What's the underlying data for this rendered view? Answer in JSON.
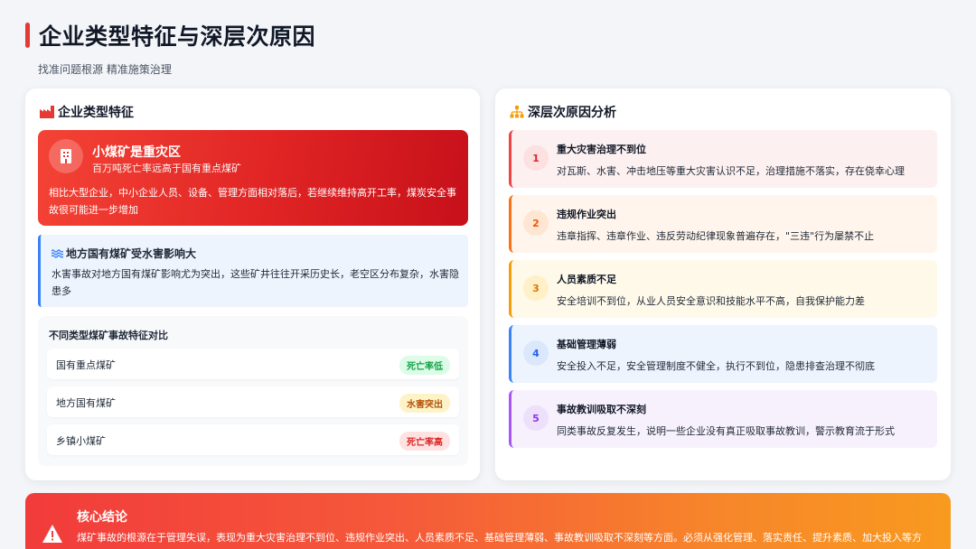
{
  "header": {
    "title": "企业类型特征与深层次原因",
    "subtitle": "找准问题根源 精准施策治理"
  },
  "left_card": {
    "title": "企业类型特征",
    "hero": {
      "title": "小煤矿是重灾区",
      "subtitle": "百万吨死亡率远高于国有重点煤矿",
      "body": "相比大型企业，中小企业人员、设备、管理方面相对落后，若继续维持高开工率，煤炭安全事故很可能进一步增加"
    },
    "water": {
      "title": "地方国有煤矿受水害影响大",
      "body": "水害事故对地方国有煤矿影响尤为突出，这些矿井往往开采历史长，老空区分布复杂，水害隐患多"
    },
    "compare": {
      "title": "不同类型煤矿事故特征对比",
      "rows": [
        {
          "name": "国有重点煤矿",
          "tag": "死亡率低",
          "tag_color": "#16a34a",
          "tag_bg": "#dcfce7"
        },
        {
          "name": "地方国有煤矿",
          "tag": "水害突出",
          "tag_color": "#b45309",
          "tag_bg": "#fef3c7"
        },
        {
          "name": "乡镇小煤矿",
          "tag": "死亡率高",
          "tag_color": "#dc2626",
          "tag_bg": "#fee2e2"
        }
      ]
    }
  },
  "right_card": {
    "title": "深层次原因分析",
    "causes": [
      {
        "num": "1",
        "title": "重大灾害治理不到位",
        "desc": "对瓦斯、水害、冲击地压等重大灾害认识不足，治理措施不落实，存在侥幸心理",
        "bg": "#fdf0f0",
        "accent": "#ef4444",
        "num_bg": "#fde0e0",
        "num_color": "#dc2626"
      },
      {
        "num": "2",
        "title": "违规作业突出",
        "desc": "违章指挥、违章作业、违反劳动纪律现象普遍存在，\"三违\"行为屡禁不止",
        "bg": "#fff5ec",
        "accent": "#f97316",
        "num_bg": "#ffe6d2",
        "num_color": "#ea580c"
      },
      {
        "num": "3",
        "title": "人员素质不足",
        "desc": "安全培训不到位，从业人员安全意识和技能水平不高，自我保护能力差",
        "bg": "#fff9ea",
        "accent": "#f59e0b",
        "num_bg": "#fff0c8",
        "num_color": "#d97706"
      },
      {
        "num": "4",
        "title": "基础管理薄弱",
        "desc": "安全投入不足，安全管理制度不健全，执行不到位，隐患排查治理不彻底",
        "bg": "#eef4fd",
        "accent": "#3b82f6",
        "num_bg": "#dbe8fc",
        "num_color": "#2563eb"
      },
      {
        "num": "5",
        "title": "事故教训吸取不深刻",
        "desc": "同类事故反复发生，说明一些企业没有真正吸取事故教训，警示教育流于形式",
        "bg": "#f7f1fd",
        "accent": "#a855f7",
        "num_bg": "#ede0fb",
        "num_color": "#9333ea"
      }
    ]
  },
  "conclusion": {
    "title": "核心结论",
    "body": "煤矿事故的根源在于管理失误，表现为重大灾害治理不到位、违规作业突出、人员素质不足、基础管理薄弱、事故教训吸取不深刻等方面。必须从强化管理、落实责任、提升素质、加大投入等方"
  },
  "colors": {
    "accent_red": "#e53935",
    "hero_red": "#e02424",
    "info_blue": "#3b82f6",
    "conclusion_orange": "#f89a1f"
  },
  "icons": {
    "left_card": "factory-icon",
    "right_card": "sitemap-icon",
    "hero": "building-icon",
    "water": "water-wave-icon",
    "conclusion": "warning-triangle-icon"
  }
}
